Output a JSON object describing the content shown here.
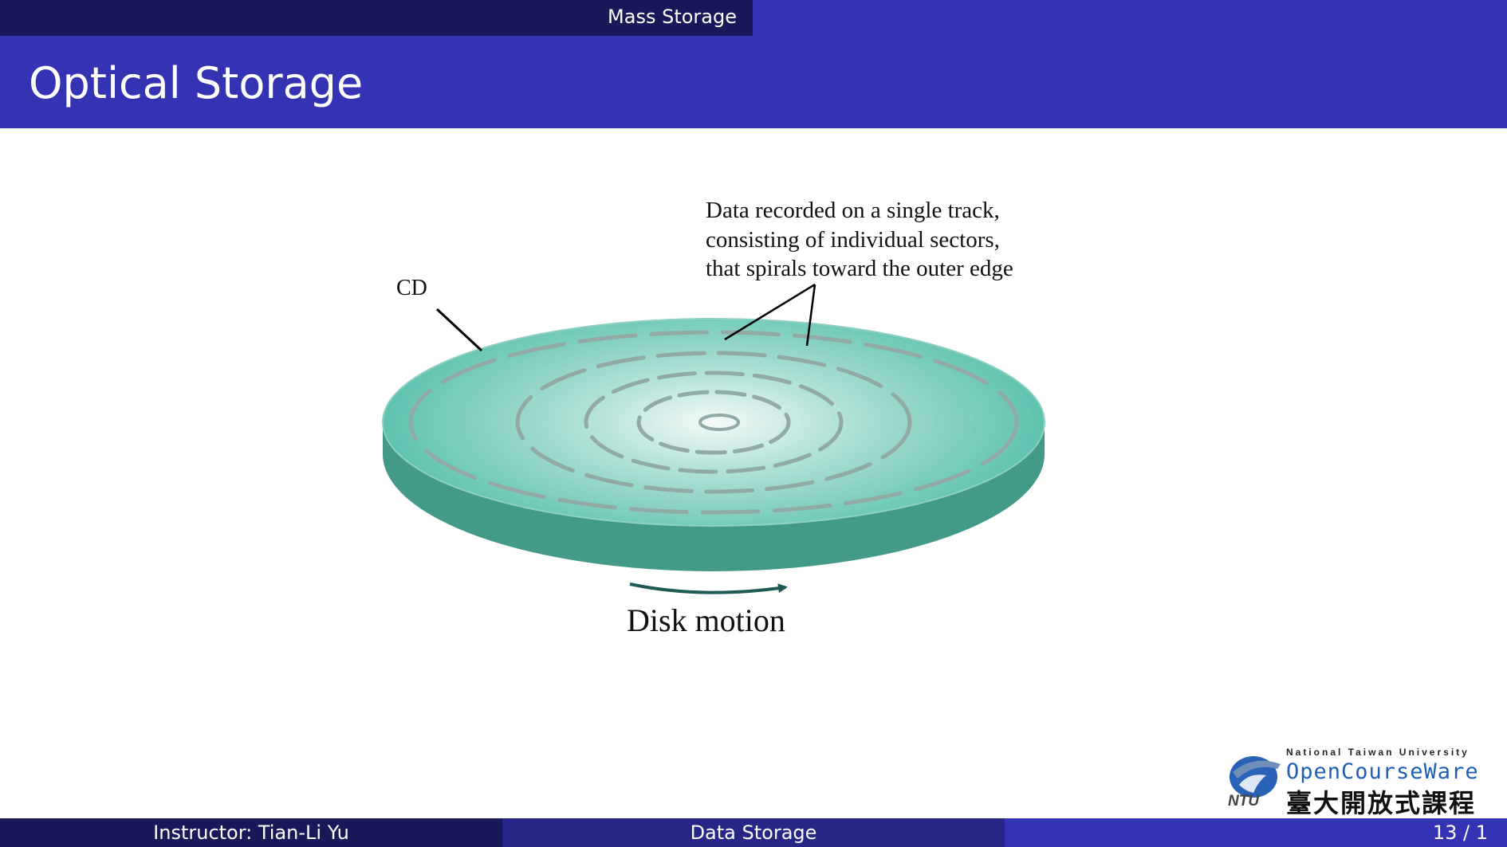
{
  "header": {
    "section": "Mass Storage"
  },
  "slide": {
    "title": "Optical Storage"
  },
  "figure": {
    "cd_label": "CD",
    "annotation_lines": [
      "Data recorded on a single track,",
      "consisting of individual sectors,",
      "that spirals toward the outer edge"
    ],
    "motion_label": "Disk motion",
    "colors": {
      "disk_top": "#5cc2ad",
      "disk_side": "#449a88",
      "track": "#92aaa6"
    }
  },
  "logo": {
    "top_text": "National Taiwan University",
    "main_text": "OpenCourseWare",
    "cjk_text": "臺大開放式課程",
    "ntu_text": "NTU"
  },
  "footer": {
    "instructor": "Instructor: Tian-Li Yu",
    "course": "Data Storage",
    "page": "13 / 1"
  }
}
